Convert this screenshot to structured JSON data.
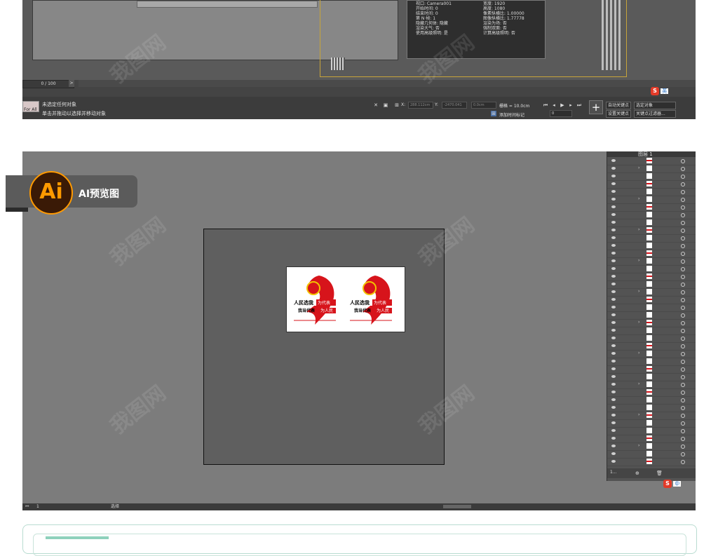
{
  "max_window": {
    "render_info": [
      "视口: Camera001",
      "开始时间: 0",
      "结束时间: 0",
      "第 N 帧: 1",
      "隐藏几何体: 隐藏",
      "渲染大气: 否",
      "使用高级照明: 是"
    ],
    "render_info_right": [
      "宽度: 1920",
      "高度: 1080",
      "像素纵横比: 1.00000",
      "图像纵横比: 1.77778",
      "渲染为场: 否",
      "强制双面: 否",
      "计算高级照明: 否"
    ],
    "time_slider": "0 / 100",
    "time_slider_next": ">",
    "status_line1": "未选定任何对象",
    "status_line2": "单击并拖动以选择并移动对象",
    "swatch_label": "For All",
    "x_label": "X:",
    "x_value": "288.112cm",
    "y_label": "Y:",
    "y_value": "-2470.041",
    "z_value": "0.0cm",
    "grid": "栅格 = 10.0cm",
    "add_time_tag": "添加时间标记",
    "auto_key": "自动关键点",
    "set_key": "设置关键点",
    "selected_object": "选定对象",
    "key_filter": "关键点过滤器...",
    "frame_value": "0",
    "ime_label": "英",
    "ime_s": "S"
  },
  "ai_window": {
    "badge_logo": "Ai",
    "badge_text": "AI预览图",
    "artwork_text_1": "人民选我",
    "artwork_text_2": "为代表",
    "artwork_text_3": "我当代表",
    "artwork_text_4": "为人民",
    "layer_top_name": "图层 1",
    "layer_count": "1...",
    "ai_page": "1",
    "ai_tool": "选择",
    "ime_label": "中",
    "ime_s": "S"
  },
  "watermark": "我图网",
  "colors": {
    "ai_orange": "#ff9a00",
    "emblem_red": "#d7141b",
    "ime_red": "#e23a28",
    "viewport_outline": "#c7a43a"
  }
}
